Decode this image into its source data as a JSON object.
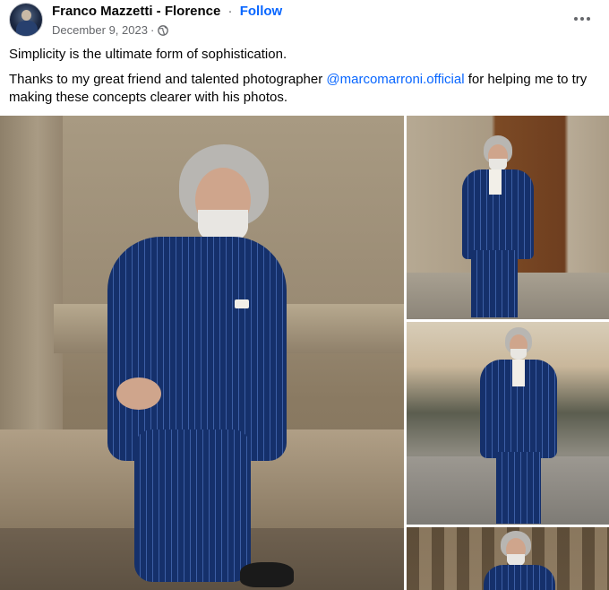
{
  "post": {
    "author": "Franco Mazzetti - Florence",
    "separator": "·",
    "follow_label": "Follow",
    "date": "December 9, 2023",
    "date_separator": "·",
    "privacy_icon": "globe-icon",
    "more_icon": "more-options-icon"
  },
  "body": {
    "line1": "Simplicity is the ultimate form of sophistication.",
    "line2_before": "Thanks to my great friend and talented photographer ",
    "mention": "@marcomarroni.official",
    "line2_after": " for helping me to try making these concepts clearer with his photos."
  },
  "colors": {
    "link": "#0866ff",
    "secondary_text": "#65676b",
    "primary_text": "#050505",
    "suit_blue": "#15306b"
  },
  "photos": [
    {
      "name": "main-photo",
      "subject": "man in navy pinstripe double-breasted suit seated on stone bench"
    },
    {
      "name": "side-photo-1",
      "subject": "man standing in front of wooden door"
    },
    {
      "name": "side-photo-2",
      "subject": "man walking in piazza"
    },
    {
      "name": "side-photo-3",
      "subject": "man near rusticated stone wall"
    }
  ]
}
